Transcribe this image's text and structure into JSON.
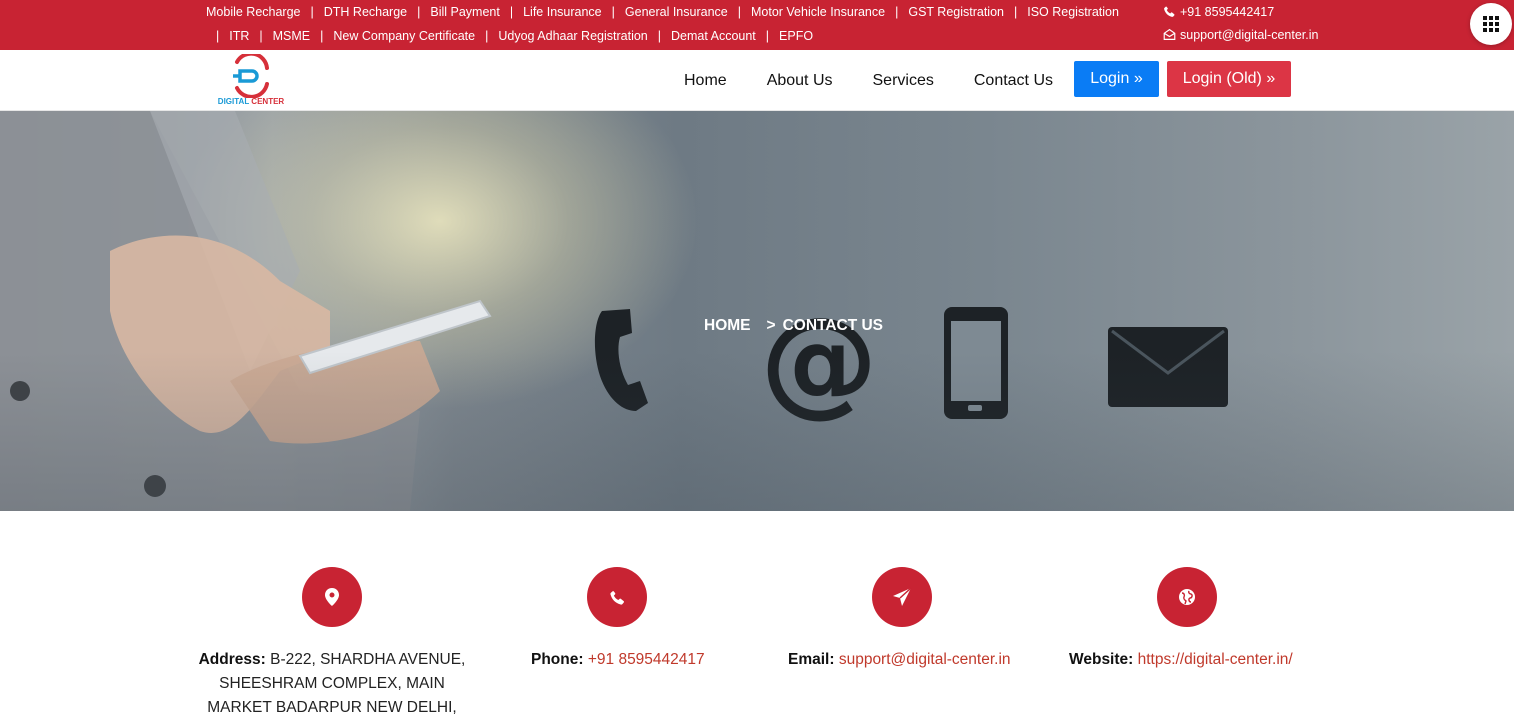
{
  "topbar": {
    "row1_links": [
      "Mobile Recharge",
      "DTH Recharge",
      "Bill Payment",
      "Life Insurance",
      "General Insurance",
      "Motor Vehicle Insurance",
      "GST Registration",
      "ISO Registration"
    ],
    "row2_links": [
      "ITR",
      "MSME",
      "New Company Certificate",
      "Udyog Adhaar Registration",
      "Demat Account",
      "EPFO"
    ],
    "phone": "+91 8595442417",
    "email": "support@digital-center.in",
    "separator": "|"
  },
  "logo": {
    "word1": "DIGITAL",
    "word2": "CENTER"
  },
  "nav": {
    "items": [
      "Home",
      "About Us",
      "Services",
      "Contact Us"
    ],
    "login_label": "Login",
    "login_old_label": "Login (Old)",
    "chevron": "»"
  },
  "hero": {
    "breadcrumb_home": "HOME",
    "breadcrumb_sep": ">",
    "breadcrumb_current": "CONTACT US"
  },
  "contact": {
    "address_label": "Address:",
    "address_value": "B-222, SHARDHA AVENUE, SHEESHRAM COMPLEX, MAIN MARKET BADARPUR NEW DELHI,",
    "phone_label": "Phone:",
    "phone_value": "+91 8595442417",
    "email_label": "Email:",
    "email_value": "support@digital-center.in",
    "website_label": "Website:",
    "website_value": "https://digital-center.in/"
  },
  "colors": {
    "brand_red": "#c82333",
    "login_blue": "#0a7cf5",
    "login_old_red": "#dc3545",
    "link_red": "#c0392b"
  },
  "icons": [
    "phone-icon",
    "envelope-icon",
    "grid-menu-icon",
    "map-marker-icon",
    "phone-icon",
    "paper-plane-icon",
    "globe-icon"
  ]
}
